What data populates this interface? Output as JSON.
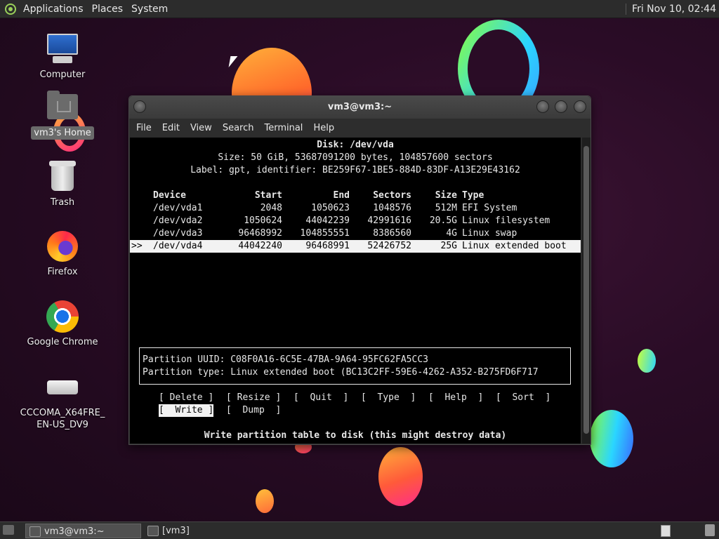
{
  "top_panel": {
    "menus": [
      "Applications",
      "Places",
      "System"
    ],
    "clock": "Fri Nov 10, 02:44"
  },
  "desktop_icons": [
    {
      "label": "Computer",
      "icon": "computer-icon"
    },
    {
      "label": "vm3's Home",
      "icon": "home-folder-icon"
    },
    {
      "label": "Trash",
      "icon": "trash-icon"
    },
    {
      "label": "Firefox",
      "icon": "firefox-icon"
    },
    {
      "label": "Google Chrome",
      "icon": "chrome-icon"
    },
    {
      "label": "CCCOMA_X64FRE_\nEN-US_DV9",
      "icon": "drive-icon"
    }
  ],
  "window": {
    "title": "vm3@vm3:~",
    "menu": [
      "File",
      "Edit",
      "View",
      "Search",
      "Terminal",
      "Help"
    ]
  },
  "cfdisk": {
    "disk_line": "Disk: /dev/vda",
    "size_line": "Size: 50 GiB, 53687091200 bytes, 104857600 sectors",
    "label_line": "Label: gpt, identifier: BE259F67-1BE5-884D-83DF-A13E29E43162",
    "headers": {
      "device": "Device",
      "start": "Start",
      "end": "End",
      "sectors": "Sectors",
      "size": "Size",
      "type": "Type"
    },
    "rows": [
      {
        "marker": "",
        "device": "/dev/vda1",
        "start": "2048",
        "end": "1050623",
        "sectors": "1048576",
        "size": "512M",
        "type": "EFI System"
      },
      {
        "marker": "",
        "device": "/dev/vda2",
        "start": "1050624",
        "end": "44042239",
        "sectors": "42991616",
        "size": "20.5G",
        "type": "Linux filesystem"
      },
      {
        "marker": "",
        "device": "/dev/vda3",
        "start": "96468992",
        "end": "104855551",
        "sectors": "8386560",
        "size": "4G",
        "type": "Linux swap"
      },
      {
        "marker": ">>",
        "device": "/dev/vda4",
        "start": "44042240",
        "end": "96468991",
        "sectors": "52426752",
        "size": "25G",
        "type": "Linux extended boot"
      }
    ],
    "uuid_line": "Partition UUID: C08F0A16-6C5E-47BA-9A64-95FC62FA5CC3",
    "type_line": "Partition type: Linux extended boot (BC13C2FF-59E6-4262-A352-B275FD6F717",
    "buttons": [
      "[ Delete ]",
      "[ Resize ]",
      "[  Quit  ]",
      "[  Type  ]",
      "[  Help  ]",
      "[  Sort  ]",
      "[  Write ]",
      "[  Dump  ]"
    ],
    "hint": "Write partition table to disk (this might destroy data)"
  },
  "taskbar": {
    "items": [
      "vm3@vm3:~",
      "[vm3]"
    ]
  }
}
